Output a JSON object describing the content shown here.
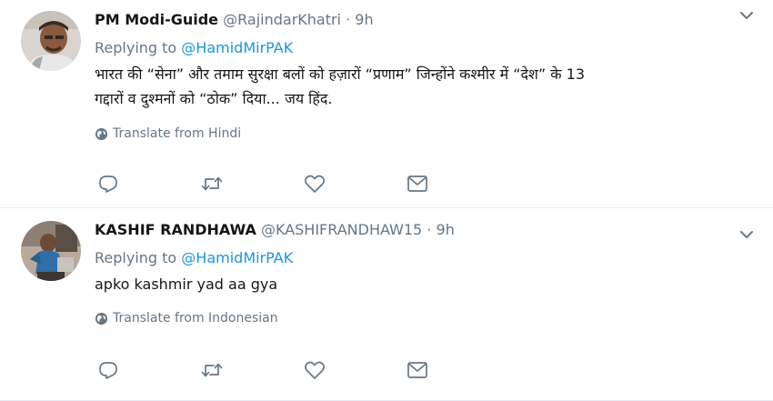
{
  "tweets": [
    {
      "fullname": "PM Modi-Guide",
      "handle": "@RajindarKhatri",
      "separator": "·",
      "time": "9h",
      "replying_prefix": "Replying to",
      "replying_to": "@HamidMirPAK",
      "text_line1": "भारत की “सेना” और तमाम सुरक्षा बलों को हज़ारों “प्रणाम” जिन्होंने कश्मीर में “देश” के 13",
      "text_line2": "गद्दारों व दुश्मनों को “ठोक” दिया... जय हिंद.",
      "translate": "Translate from Hindi"
    },
    {
      "fullname": "KASHIF RANDHAWA",
      "handle": "@KASHIFRANDHAW15",
      "separator": "·",
      "time": "9h",
      "replying_prefix": "Replying to",
      "replying_to": "@HamidMirPAK",
      "text_line1": "apko kashmir yad aa gya",
      "translate": "Translate from Indonesian"
    }
  ],
  "icons": {
    "reply": "reply-icon",
    "retweet": "retweet-icon",
    "like": "heart-icon",
    "dm": "envelope-icon",
    "globe": "globe-icon",
    "caret": "chevron-down-icon"
  },
  "colors": {
    "text": "#14171a",
    "muted": "#657786",
    "link": "#1b95e0",
    "divider": "#e6ecf0"
  }
}
